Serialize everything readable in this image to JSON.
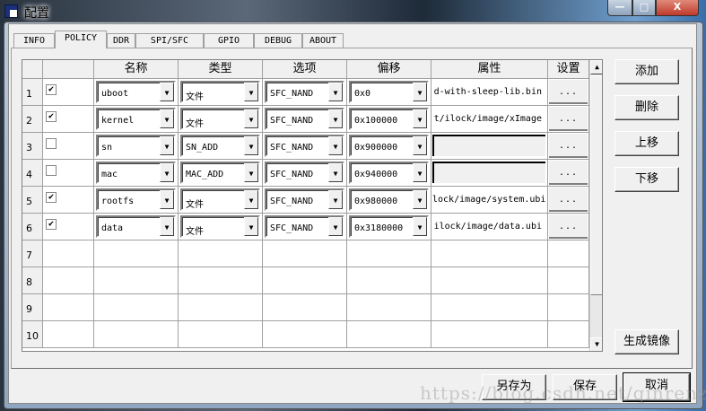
{
  "window": {
    "title": "配置",
    "controls": {
      "minimize": "—",
      "maximize": "□",
      "close": "X"
    }
  },
  "tabs": [
    {
      "label": "INFO"
    },
    {
      "label": "POLICY",
      "active": true
    },
    {
      "label": "DDR"
    },
    {
      "label": "SPI/SFC"
    },
    {
      "label": "GPIO"
    },
    {
      "label": "DEBUG"
    },
    {
      "label": "ABOUT"
    }
  ],
  "grid": {
    "headers": [
      "名称",
      "类型",
      "选项",
      "偏移",
      "属性",
      "设置"
    ],
    "rows": [
      {
        "num": "1",
        "checked": true,
        "name": "uboot",
        "type": "文件",
        "option": "SFC_NAND",
        "offset": "0x0",
        "attr": "d-with-sleep-lib.bin",
        "set": "..."
      },
      {
        "num": "2",
        "checked": true,
        "name": "kernel",
        "type": "文件",
        "option": "SFC_NAND",
        "offset": "0x100000",
        "attr": "t/ilock/image/xImage",
        "set": "..."
      },
      {
        "num": "3",
        "checked": false,
        "name": "sn",
        "type": "SN_ADD",
        "option": "SFC_NAND",
        "offset": "0x900000",
        "attr": "",
        "set": "..."
      },
      {
        "num": "4",
        "checked": false,
        "name": "mac",
        "type": "MAC_ADD",
        "option": "SFC_NAND",
        "offset": "0x940000",
        "attr": "",
        "set": "..."
      },
      {
        "num": "5",
        "checked": true,
        "name": "rootfs",
        "type": "文件",
        "option": "SFC_NAND",
        "offset": "0x980000",
        "attr": "lock/image/system.ubi",
        "set": "..."
      },
      {
        "num": "6",
        "checked": true,
        "name": "data",
        "type": "文件",
        "option": "SFC_NAND",
        "offset": "0x3180000",
        "attr": "ilock/image/data.ubi",
        "set": "..."
      },
      {
        "num": "7"
      },
      {
        "num": "8"
      },
      {
        "num": "9"
      },
      {
        "num": "10"
      }
    ]
  },
  "side_buttons": {
    "add": "添加",
    "delete": "删除",
    "move_up": "上移",
    "move_down": "下移",
    "generate_image": "生成镜像"
  },
  "bottom_buttons": {
    "save_as": "另存为",
    "save": "保存",
    "cancel": "取消"
  },
  "watermark": "https://blog.csdn.net/qinrenzhi"
}
